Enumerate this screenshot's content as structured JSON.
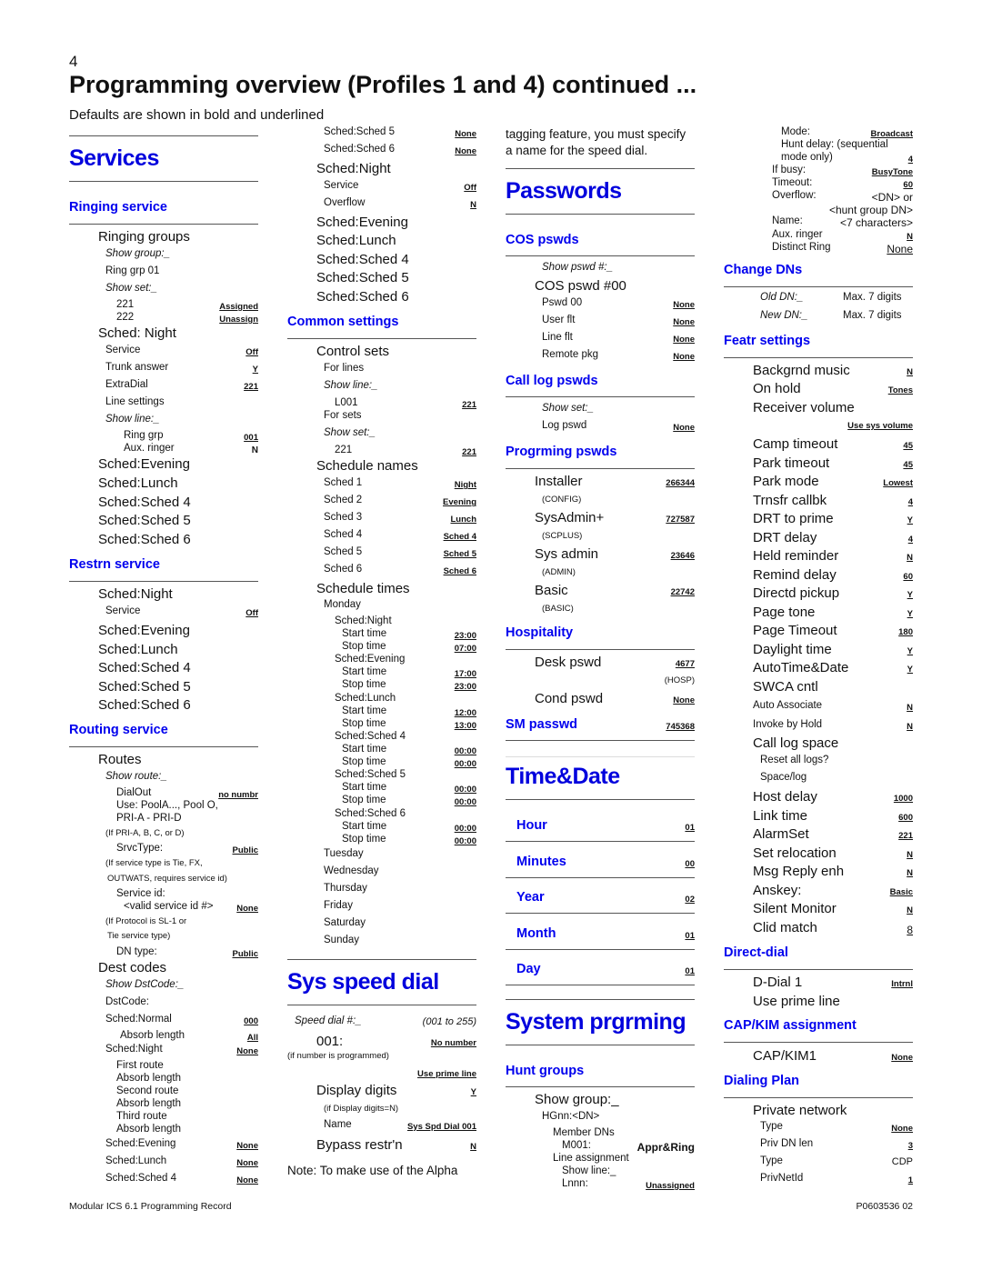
{
  "page": {
    "number": "4",
    "title": "Programming overview (Profiles 1 and 4) continued ...",
    "subtitle": "Defaults are shown in bold and underlined",
    "footer_left": "Modular ICS 6.1 Programming Record",
    "footer_right": "P0603536  02"
  },
  "col1": {
    "services": "Services",
    "ringing_service": "Ringing service",
    "ringing_groups": "Ringing groups",
    "show_group": "Show group:_",
    "ring_grp_01": "Ring grp 01",
    "show_set": "Show set:_",
    "set_221": "221",
    "set_221_val": "Assigned",
    "set_222": "222",
    "set_222_val": "Unassign",
    "sched_night": "Sched: Night",
    "service": "Service",
    "service_val": "Off",
    "trunk_answer": "Trunk answer",
    "trunk_answer_val": "Y",
    "extradial": "ExtraDial",
    "extradial_val": "221",
    "line_settings": "Line settings",
    "show_line": "Show line:_",
    "ring_grp": "Ring grp",
    "ring_grp_val": "001",
    "aux_ringer": "Aux. ringer",
    "aux_ringer_val": "N",
    "ring_scheds": [
      "Sched:Evening",
      "Sched:Lunch",
      "Sched:Sched 4",
      "Sched:Sched 5",
      "Sched:Sched 6"
    ],
    "restrn_service": "Restrn service",
    "restrn_night": "Sched:Night",
    "restrn_service_lbl": "Service",
    "restrn_service_val": "Off",
    "restrn_scheds": [
      "Sched:Evening",
      "Sched:Lunch",
      "Sched:Sched 4",
      "Sched:Sched 5",
      "Sched:Sched 6"
    ],
    "routing_service": "Routing service",
    "routes": "Routes",
    "show_route": "Show route:_",
    "dialout": "DialOut",
    "dialout_val": "no numbr",
    "use_pool": "Use: PoolA..., Pool O,",
    "pri": "PRI-A - PRI-D",
    "if_pri": "(If PRI-A, B, C, or D)",
    "srvctype": "SrvcType:",
    "srvctype_val": "Public",
    "if_service_1": "(If service type is Tie, FX,",
    "if_service_2": "OUTWATS, requires service id)",
    "service_id": "Service id:",
    "valid_service_id": "<valid service id #>",
    "valid_service_id_val": "None",
    "if_protocol_1": "(If Protocol is SL-1 or",
    "if_protocol_2": "Tie service type)",
    "dn_type": "DN type:",
    "dn_type_val": "Public",
    "dest_codes": "Dest codes",
    "show_dstcode": "Show DstCode:_",
    "dstcode": "DstCode:",
    "sched_normal": "Sched:Normal",
    "sched_normal_val": "000",
    "absorb_length": "Absorb length",
    "absorb_length_val": "All",
    "dst_night": "Sched:Night",
    "dst_night_val": "None",
    "route_lines": [
      "First route",
      "Absorb length",
      "Second route",
      "Absorb length",
      "Third route",
      "Absorb length"
    ],
    "dst_evening": "Sched:Evening",
    "dst_evening_val": "None",
    "dst_lunch": "Sched:Lunch",
    "dst_lunch_val": "None",
    "dst_sched4": "Sched:Sched 4",
    "dst_sched4_val": "None"
  },
  "col2": {
    "dst_sched5": "Sched:Sched 5",
    "dst_sched5_val": "None",
    "dst_sched6": "Sched:Sched 6",
    "dst_sched6_val": "None",
    "sched_night": "Sched:Night",
    "service": "Service",
    "service_val": "Off",
    "overflow": "Overflow",
    "overflow_val": "N",
    "scheds": [
      "Sched:Evening",
      "Sched:Lunch",
      "Sched:Sched 4",
      "Sched:Sched 5",
      "Sched:Sched 6"
    ],
    "common_settings": "Common settings",
    "control_sets": "Control sets",
    "for_lines": "For lines",
    "show_line": "Show line:_",
    "l001": "L001",
    "l001_val": "221",
    "for_sets": "For sets",
    "show_set": "Show set:_",
    "set221": "221",
    "set221_val": "221",
    "schedule_names": "Schedule names",
    "sched_names": [
      {
        "label": "Sched 1",
        "value": "Night"
      },
      {
        "label": "Sched 2",
        "value": "Evening"
      },
      {
        "label": "Sched 3",
        "value": "Lunch"
      },
      {
        "label": "Sched 4",
        "value": "Sched 4"
      },
      {
        "label": "Sched 5",
        "value": "Sched 5"
      },
      {
        "label": "Sched 6",
        "value": "Sched 6"
      }
    ],
    "schedule_times": "Schedule times",
    "monday": "Monday",
    "times": [
      {
        "sched": "Sched:Night",
        "start": "23:00",
        "stop": "07:00"
      },
      {
        "sched": "Sched:Evening",
        "start": "17:00",
        "stop": "23:00"
      },
      {
        "sched": "Sched:Lunch",
        "start": "12:00",
        "stop": "13:00"
      },
      {
        "sched": "Sched:Sched 4",
        "start": "00:00",
        "stop": "00:00"
      },
      {
        "sched": "Sched:Sched 5",
        "start": "00:00",
        "stop": "00:00"
      },
      {
        "sched": "Sched:Sched 6",
        "start": "00:00",
        "stop": "00:00"
      }
    ],
    "start_time": "Start time",
    "stop_time": "Stop time",
    "days": [
      "Tuesday",
      "Wednesday",
      "Thursday",
      "Friday",
      "Saturday",
      "Sunday"
    ],
    "sys_speed_dial": "Sys speed dial",
    "speed_dial": "Speed dial #:_",
    "speed_dial_range": "(001 to 255)",
    "sd_001": "001:",
    "sd_001_val": "No number",
    "if_number": "(if number is programmed)",
    "use_prime_line": "Use prime line",
    "display_digits": "Display digits",
    "display_digits_val": "Y",
    "if_display": "(if Display digits=N)",
    "name": "Name",
    "name_val": "Sys Spd Dial 001",
    "bypass": "Bypass restr'n",
    "bypass_val": "N",
    "note": "Note: To make use of the Alpha"
  },
  "col3": {
    "note_cont_1": "tagging feature, you must specify",
    "note_cont_2": "a name for the speed dial.",
    "passwords": "Passwords",
    "cos_pswds": "COS pswds",
    "show_pswd": "Show pswd #:_",
    "cos_pswd_00": "COS pswd #00",
    "cos_items": [
      {
        "label": "Pswd 00",
        "value": "None"
      },
      {
        "label": "User flt",
        "value": "None"
      },
      {
        "label": "Line flt",
        "value": "None"
      },
      {
        "label": "Remote pkg",
        "value": "None"
      }
    ],
    "call_log_pswds": "Call log pswds",
    "show_set": "Show set:_",
    "log_pswd": "Log pswd",
    "log_pswd_val": "None",
    "progrming_pswds": "Progrming pswds",
    "prog_items": [
      {
        "label": "Installer",
        "value": "266344",
        "sub": "(CONFIG)"
      },
      {
        "label": "SysAdmin+",
        "value": "727587",
        "sub": "(SCPLUS)"
      },
      {
        "label": "Sys admin",
        "value": "23646",
        "sub": "(ADMIN)"
      },
      {
        "label": "Basic",
        "value": "22742",
        "sub": "(BASIC)"
      }
    ],
    "hospitality": "Hospitality",
    "desk_pswd": "Desk pswd",
    "desk_pswd_val": "4677",
    "hosp": "(HOSP)",
    "cond_pswd": "Cond pswd",
    "cond_pswd_val": "None",
    "sm_passwd": "SM passwd",
    "sm_passwd_val": "745368",
    "time_date": "Time&Date",
    "time_items": [
      {
        "label": "Hour",
        "value": "01"
      },
      {
        "label": "Minutes",
        "value": "00"
      },
      {
        "label": "Year",
        "value": "02"
      },
      {
        "label": "Month",
        "value": "01"
      },
      {
        "label": "Day",
        "value": "01"
      }
    ],
    "system_prgrming": "System prgrming",
    "hunt_groups": "Hunt groups",
    "show_group": "Show group:_",
    "hgnn": "HGnn:<DN>",
    "member_dns": "Member DNs",
    "m001": "M001:",
    "m001_val": "Appr&Ring",
    "line_assignment": "Line assignment",
    "show_line": "Show line:_",
    "lnnn": "Lnnn:",
    "lnnn_val": "Unassigned"
  },
  "col4": {
    "mode": "Mode:",
    "mode_val": "Broadcast",
    "hunt_delay_1": "Hunt delay: (sequential",
    "hunt_delay_2": "mode only)",
    "hunt_delay_val": "4",
    "if_busy": "If busy:",
    "if_busy_val": "BusyTone",
    "timeout": "Timeout:",
    "timeout_val": "60",
    "overflow": "Overflow:",
    "overflow_val": "<DN> or",
    "overflow_val2": "<hunt group DN>",
    "name": "Name:",
    "name_val": "<7 characters>",
    "aux_ringer": "Aux. ringer",
    "aux_ringer_val": "N",
    "distinct_ring": "Distinct Ring",
    "distinct_ring_val": "None",
    "change_dns": "Change DNs",
    "old_dn": "Old DN:_",
    "old_dn_val": "Max. 7 digits",
    "new_dn": "New DN:_",
    "new_dn_val": "Max. 7 digits",
    "featr_settings": "Featr settings",
    "backgrnd_music": "Backgrnd music",
    "backgrnd_music_val": "N",
    "on_hold": "On hold",
    "on_hold_val": "Tones",
    "receiver_volume": "Receiver volume",
    "receiver_volume_val": "Use sys volume",
    "feat_items": [
      {
        "label": "Camp timeout",
        "value": "45"
      },
      {
        "label": "Park timeout",
        "value": "45"
      },
      {
        "label": "Park mode",
        "value": "Lowest"
      },
      {
        "label": "Trnsfr callbk",
        "value": "4"
      },
      {
        "label": "DRT to prime",
        "value": "Y"
      },
      {
        "label": "DRT delay",
        "value": "4"
      },
      {
        "label": "Held reminder",
        "value": "N"
      },
      {
        "label": "Remind delay",
        "value": "60"
      },
      {
        "label": "Directd pickup",
        "value": "Y"
      },
      {
        "label": "Page tone",
        "value": "Y"
      },
      {
        "label": "Page Timeout",
        "value": "180"
      },
      {
        "label": "Daylight time",
        "value": "Y"
      },
      {
        "label": "AutoTime&Date",
        "value": "Y"
      }
    ],
    "swca_cntl": "SWCA cntl",
    "auto_associate": "Auto Associate",
    "auto_associate_val": "N",
    "invoke_by_hold": "Invoke by Hold",
    "invoke_by_hold_val": "N",
    "call_log_space": "Call log space",
    "reset_all_logs": "Reset all logs?",
    "space_log": "Space/log",
    "feat_items2": [
      {
        "label": "Host delay",
        "value": "1000"
      },
      {
        "label": "Link time",
        "value": "600"
      },
      {
        "label": "AlarmSet",
        "value": "221"
      },
      {
        "label": "Set relocation",
        "value": "N"
      },
      {
        "label": "Msg Reply enh",
        "value": "N"
      },
      {
        "label": "Anskey:",
        "value": "Basic"
      },
      {
        "label": "Silent Monitor",
        "value": "N"
      }
    ],
    "clid_match": "Clid match",
    "clid_match_val": "8",
    "direct_dial": "Direct-dial",
    "d_dial_1": "D-Dial 1",
    "d_dial_1_val": "Intrnl",
    "use_prime_line": "Use prime line",
    "cap_kim_assignment": "CAP/KIM assignment",
    "cap_kim1": "CAP/KIM1",
    "cap_kim1_val": "None",
    "dialing_plan": "Dialing Plan",
    "private_network": "Private network",
    "type1": "Type",
    "type1_val": "None",
    "priv_dn_len": "Priv DN len",
    "priv_dn_len_val": "3",
    "type2": "Type",
    "type2_val": "CDP",
    "privnetid": "PrivNetId",
    "privnetid_val": "1"
  }
}
